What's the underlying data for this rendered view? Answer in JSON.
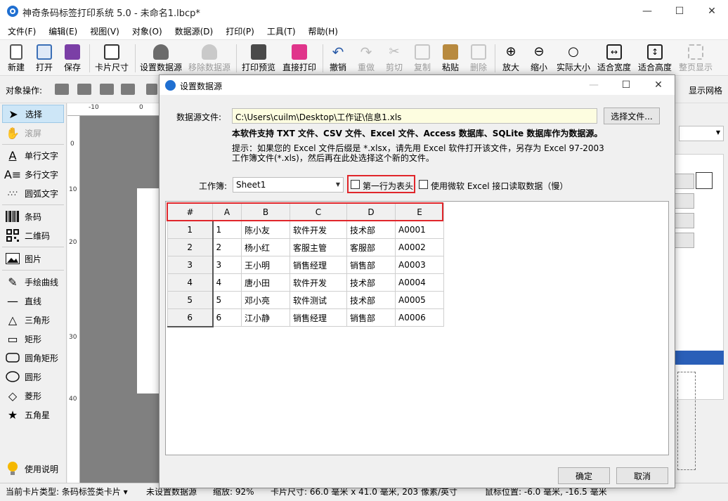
{
  "window": {
    "title": "神奇条码标签打印系统 5.0 - 未命名1.lbcp*",
    "controls": [
      "—",
      "☐",
      "✕"
    ]
  },
  "menu": [
    "文件(F)",
    "编辑(E)",
    "视图(V)",
    "对象(O)",
    "数据源(D)",
    "打印(P)",
    "工具(T)",
    "帮助(H)"
  ],
  "toolbar": {
    "new": "新建",
    "open": "打开",
    "save": "保存",
    "card_size": "卡片尺寸",
    "set_datasource": "设置数据源",
    "remove_datasource": "移除数据源",
    "print_preview": "打印预览",
    "direct_print": "直接打印",
    "undo": "撤销",
    "redo": "重做",
    "cut": "剪切",
    "copy": "复制",
    "paste": "粘贴",
    "delete": "删除",
    "zoom_in": "放大",
    "zoom_out": "缩小",
    "actual_size": "实际大小",
    "fit_width": "适合宽度",
    "fit_height": "适合高度",
    "show_page": "整页显示"
  },
  "object_ops": {
    "label": "对象操作:",
    "show_grid": "显示网格"
  },
  "tools": [
    {
      "label": "选择",
      "icon": "cursor-arrow-icon"
    },
    {
      "label": "滚屏",
      "icon": "hand-icon"
    },
    {
      "label": "单行文字",
      "icon": "single-line-text-icon"
    },
    {
      "label": "多行文字",
      "icon": "multi-line-text-icon"
    },
    {
      "label": "圆弧文字",
      "icon": "arc-text-icon"
    },
    {
      "label": "条码",
      "icon": "barcode-icon"
    },
    {
      "label": "二维码",
      "icon": "qrcode-icon"
    },
    {
      "label": "图片",
      "icon": "image-icon"
    },
    {
      "label": "手绘曲线",
      "icon": "pen-icon"
    },
    {
      "label": "直线",
      "icon": "line-icon"
    },
    {
      "label": "三角形",
      "icon": "triangle-icon"
    },
    {
      "label": "矩形",
      "icon": "rectangle-icon"
    },
    {
      "label": "圆角矩形",
      "icon": "rounded-rectangle-icon"
    },
    {
      "label": "圆形",
      "icon": "circle-icon"
    },
    {
      "label": "菱形",
      "icon": "diamond-icon"
    },
    {
      "label": "五角星",
      "icon": "star-icon"
    },
    {
      "label": "使用说明",
      "icon": "lightbulb-icon"
    }
  ],
  "ruler": {
    "top": [
      "-10",
      "0"
    ],
    "left": [
      "0",
      "10",
      "20",
      "30",
      "40"
    ]
  },
  "dialog": {
    "title": "设置数据源",
    "file_label": "数据源文件:",
    "file_value": "C:\\Users\\cuilm\\Desktop\\工作证\\信息1.xls",
    "choose_file": "选择文件...",
    "support_note": "本软件支持 TXT 文件、CSV 文件、Excel 文件、Access 数据库、SQLite 数据库作为数据源。",
    "hint_line1": "提示：如果您的 Excel 文件后缀是 *.xlsx，请先用 Excel 软件打开该文件，另存为 Excel 97-2003",
    "hint_line2": "工作簿文件(*.xls)，然后再在此处选择这个新的文件。",
    "workbook_label": "工作簿:",
    "workbook_value": "Sheet1",
    "first_row_header": "第一行为表头",
    "use_ms_excel": "使用微软 Excel 接口读取数据（慢）",
    "ok": "确定",
    "cancel": "取消",
    "columns": [
      "#",
      "A",
      "B",
      "C",
      "D",
      "E"
    ],
    "rows": [
      [
        "1",
        "1",
        "陈小友",
        "软件开发",
        "技术部",
        "A0001"
      ],
      [
        "2",
        "2",
        "杨小红",
        "客服主管",
        "客服部",
        "A0002"
      ],
      [
        "3",
        "3",
        "王小明",
        "销售经理",
        "销售部",
        "A0003"
      ],
      [
        "4",
        "4",
        "唐小田",
        "软件开发",
        "技术部",
        "A0004"
      ],
      [
        "5",
        "5",
        "邓小亮",
        "软件测试",
        "技术部",
        "A0005"
      ],
      [
        "6",
        "6",
        "江小静",
        "销售经理",
        "销售部",
        "A0006"
      ]
    ]
  },
  "status": {
    "card_type": "当前卡片类型: 条码标签类卡片 ▾",
    "datasource": "未设置数据源",
    "zoom": "缩放: 92%",
    "card_size": "卡片尺寸: 66.0 毫米 x 41.0 毫米, 203 像素/英寸",
    "cursor": "鼠标位置: -6.0 毫米, -16.5 毫米"
  },
  "colors": {
    "accent_red": "#e0262b",
    "selection": "#cde6f7",
    "file_bg": "#fdfde0"
  }
}
